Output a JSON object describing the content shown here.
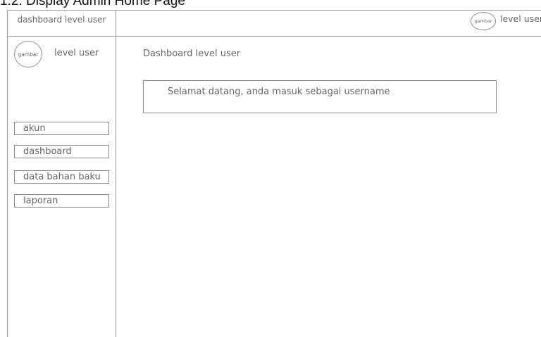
{
  "caption": "1.2. Display Admin Home Page",
  "header": {
    "brand": "dashboard level user",
    "avatar_label": "gambar",
    "user_label": "level user"
  },
  "sidebar": {
    "avatar_label": "gambar",
    "user_label": "level user",
    "items": [
      {
        "label": "akun"
      },
      {
        "label": "dashboard"
      },
      {
        "label": "data bahan baku"
      },
      {
        "label": "laporan"
      }
    ]
  },
  "main": {
    "title": "Dashboard level user",
    "welcome": "Selamat datang, anda masuk sebagai username"
  }
}
